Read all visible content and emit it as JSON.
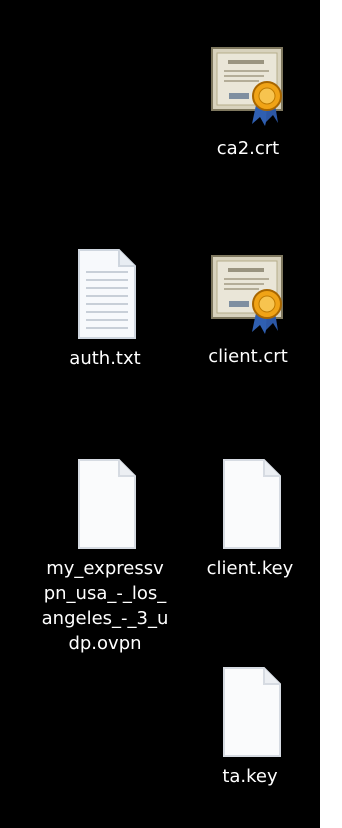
{
  "desktop": {
    "files": [
      {
        "name": "ca2.crt",
        "type": "certificate-icon"
      },
      {
        "name": "auth.txt",
        "type": "text-document-icon"
      },
      {
        "name": "client.crt",
        "type": "certificate-icon"
      },
      {
        "name": "my_expressvpn_usa_-_los_angeles_-_3_udp.ovpn",
        "type": "blank-document-icon"
      },
      {
        "name": "client.key",
        "type": "blank-document-icon"
      },
      {
        "name": "ta.key",
        "type": "blank-document-icon"
      }
    ]
  }
}
